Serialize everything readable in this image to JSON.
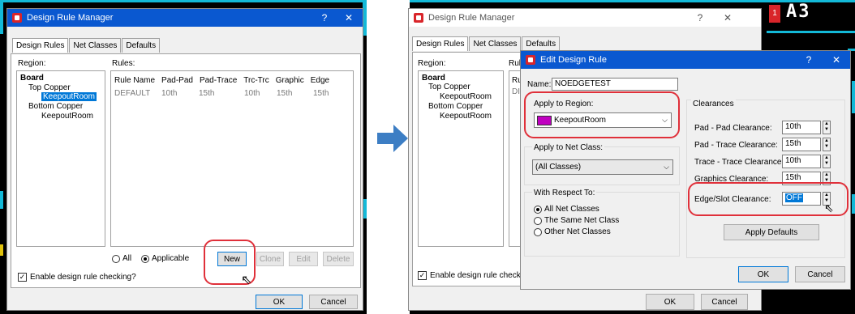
{
  "left_dialog": {
    "title": "Design Rule Manager",
    "help": "?",
    "close": "✕",
    "tabs": [
      "Design Rules",
      "Net Classes",
      "Defaults"
    ],
    "region_label": "Region:",
    "rules_label": "Rules:",
    "tree": {
      "board": "Board",
      "top_copper": "Top Copper",
      "top_keepout": "KeepoutRoom",
      "bottom_copper": "Bottom Copper",
      "bottom_keepout": "KeepoutRoom"
    },
    "table": {
      "headers": [
        "Rule Name",
        "Pad-Pad",
        "Pad-Trace",
        "Trc-Trc",
        "Graphic",
        "Edge"
      ],
      "rows": [
        [
          "DEFAULT",
          "10th",
          "15th",
          "10th",
          "15th",
          "15th"
        ]
      ]
    },
    "radio_all": "All",
    "radio_applicable": "Applicable",
    "buttons": {
      "new": "New",
      "clone": "Clone",
      "edit": "Edit",
      "delete": "Delete",
      "ok": "OK",
      "cancel": "Cancel"
    },
    "enable_check": "Enable design rule checking?"
  },
  "right_dialog": {
    "title": "Design Rule Manager",
    "help": "?",
    "close": "✕",
    "tabs": [
      "Design Rules",
      "Net Classes",
      "Defaults"
    ],
    "region_label": "Region:",
    "rules_label": "Rul",
    "tree": {
      "board": "Board",
      "top_copper": "Top Copper",
      "top_keepout": "KeepoutRoom",
      "bottom_copper": "Bottom Copper",
      "bottom_keepout": "KeepoutRoom"
    },
    "rules_partial": [
      "Ru",
      "DI"
    ],
    "enable_check": "Enable design rule checkin",
    "ok": "OK",
    "cancel": "Cancel"
  },
  "edit_dialog": {
    "title": "Edit Design Rule",
    "help": "?",
    "close": "✕",
    "name_label": "Name:",
    "name_value": "NOEDGETEST",
    "apply_region_label": "Apply to Region:",
    "region_value": "KeepoutRoom",
    "region_color": "#c000c0",
    "apply_netclass_label": "Apply to Net Class:",
    "netclass_value": "(All Classes)",
    "respect_label": "With Respect To:",
    "respect_options": [
      "All Net Classes",
      "The Same Net Class",
      "Other Net Classes"
    ],
    "clearances_label": "Clearances",
    "clearances": [
      {
        "label": "Pad - Pad Clearance:",
        "value": "10th"
      },
      {
        "label": "Pad - Trace Clearance:",
        "value": "15th"
      },
      {
        "label": "Trace - Trace Clearance:",
        "value": "10th"
      },
      {
        "label": "Graphics Clearance:",
        "value": "15th"
      },
      {
        "label": "Edge/Slot Clearance:",
        "value": "OFF"
      }
    ],
    "apply_defaults": "Apply Defaults",
    "ok": "OK",
    "cancel": "Cancel"
  },
  "pcb_label": "A3",
  "pcb_pad": "1",
  "colors": {
    "title_active": "#0a58d0",
    "arrow": "#3d7ec4",
    "highlight": "#e0303a",
    "trace": "#13b9d8",
    "selection": "#0078d7"
  }
}
